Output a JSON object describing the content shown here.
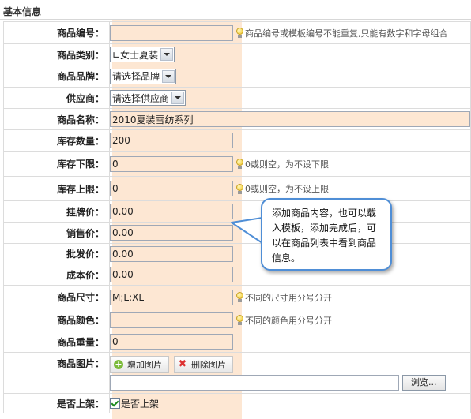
{
  "section": {
    "title": "基本信息"
  },
  "fields": {
    "product_code": {
      "label": "商品编号：",
      "value": "",
      "hint": "商品编号或模板编号不能重复,只能有数字和字母组合"
    },
    "category": {
      "label": "商品类别：",
      "selected": "∟女士夏装"
    },
    "brand": {
      "label": "商品品牌：",
      "selected": "请选择品牌"
    },
    "supplier": {
      "label": "供应商：",
      "selected": "请选择供应商"
    },
    "name": {
      "label": "商品名称：",
      "value": "2010夏装雪纺系列"
    },
    "stock_qty": {
      "label": "库存数量：",
      "value": "200"
    },
    "stock_min": {
      "label": "库存下限：",
      "value": "0",
      "hint": "0或则空，为不设下限"
    },
    "stock_max": {
      "label": "库存上限：",
      "value": "0",
      "hint": "0或则空，为不设上限"
    },
    "list_price": {
      "label": "挂牌价：",
      "value": "0.00"
    },
    "sale_price": {
      "label": "销售价：",
      "value": "0.00"
    },
    "wholesale_price": {
      "label": "批发价：",
      "value": "0.00"
    },
    "cost_price": {
      "label": "成本价：",
      "value": "0.00"
    },
    "size": {
      "label": "商品尺寸：",
      "value": "M;L;XL",
      "hint": "不同的尺寸用分号分开"
    },
    "color": {
      "label": "商品颜色：",
      "value": "",
      "hint": "不同的颜色用分号分开"
    },
    "weight": {
      "label": "商品重量：",
      "value": "0"
    },
    "image": {
      "label": "商品图片：",
      "add_label": "增加图片",
      "delete_label": "删除图片",
      "file_value": "",
      "browse_label": "浏览..."
    },
    "on_shelf": {
      "label": "是否上架：",
      "checkbox_label": "是否上架",
      "checked": true
    }
  },
  "callout": {
    "text": "添加商品内容，也可以载入模板，添加完成后，可以在商品列表中看到商品信息。"
  },
  "colors": {
    "stripe": "#fde7d3",
    "callout_border": "#4f8ed6",
    "input_border": "#9fa8b6"
  }
}
